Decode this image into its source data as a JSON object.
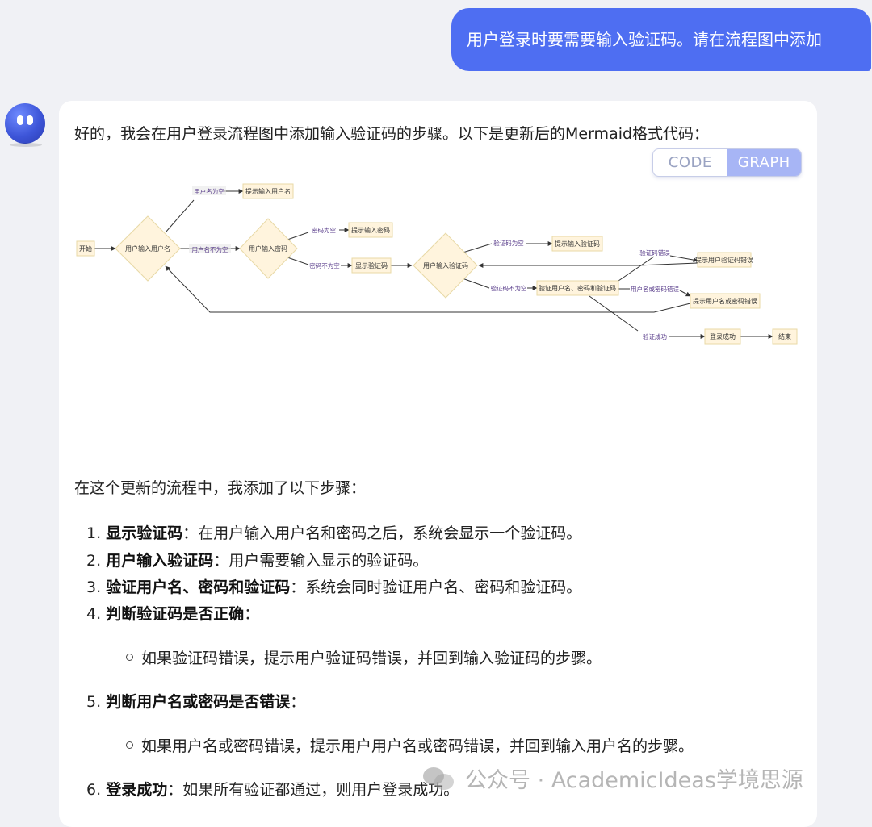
{
  "user_message": "用户登录时要需要输入验证码。请在流程图中添加",
  "assistant": {
    "intro": "好的，我会在用户登录流程图中添加输入验证码的步骤。以下是更新后的Mermaid格式代码：",
    "toggle": {
      "code_label": "CODE",
      "graph_label": "GRAPH",
      "active": "GRAPH"
    },
    "flowchart": {
      "nodes": {
        "start": "开始",
        "input_user": "用户输入用户名",
        "prompt_user": "提示输入用户名",
        "input_pwd": "用户输入密码",
        "prompt_pwd": "提示输入密码",
        "show_captcha": "显示验证码",
        "input_captcha": "用户输入验证码",
        "prompt_captcha": "提示输入验证码",
        "captcha_error": "提示用户验证码错误",
        "verify_all": "验证用户名、密码和验证码",
        "cred_error": "提示用户名或密码错误",
        "login_success": "登录成功",
        "end": "结束"
      },
      "edges": {
        "user_empty": "用户名为空",
        "user_not_empty": "用户名不为空",
        "pwd_empty": "密码为空",
        "pwd_not_empty": "密码不为空",
        "captcha_empty": "验证码为空",
        "captcha_not_empty": "验证码不为空",
        "captcha_wrong": "验证码错误",
        "cred_wrong": "用户名或密码错误",
        "verify_ok": "验证成功"
      }
    },
    "summary_title": "在这个更新的流程中，我添加了以下步骤：",
    "steps": [
      {
        "num": "1.",
        "bold": "显示验证码",
        "text": "：在用户输入用户名和密码之后，系统会显示一个验证码。"
      },
      {
        "num": "2.",
        "bold": "用户输入验证码",
        "text": "：用户需要输入显示的验证码。"
      },
      {
        "num": "3.",
        "bold": "验证用户名、密码和验证码",
        "text": "：系统会同时验证用户名、密码和验证码。"
      },
      {
        "num": "4.",
        "bold": "判断验证码是否正确",
        "text": "："
      },
      {
        "num": "5.",
        "bold": "判断用户名或密码是否错误",
        "text": "："
      },
      {
        "num": "6.",
        "bold": "登录成功",
        "text": "：如果所有验证都通过，则用户登录成功。"
      }
    ],
    "sub_items": [
      "如果验证码错误，提示用户验证码错误，并回到输入验证码的步骤。",
      "如果用户名或密码错误，提示用户用户名或密码错误，并回到输入用户名的步骤。"
    ]
  },
  "watermark": "公众号 · AcademicIdeas学境思源",
  "colors": {
    "user_bubble": "#4e6ef2",
    "node_fill": "#fff4dd",
    "node_stroke": "#e8d9a6",
    "edge": "#333333",
    "edge_label": "#5b3f8c",
    "graph_active": "#a7b5f5"
  }
}
